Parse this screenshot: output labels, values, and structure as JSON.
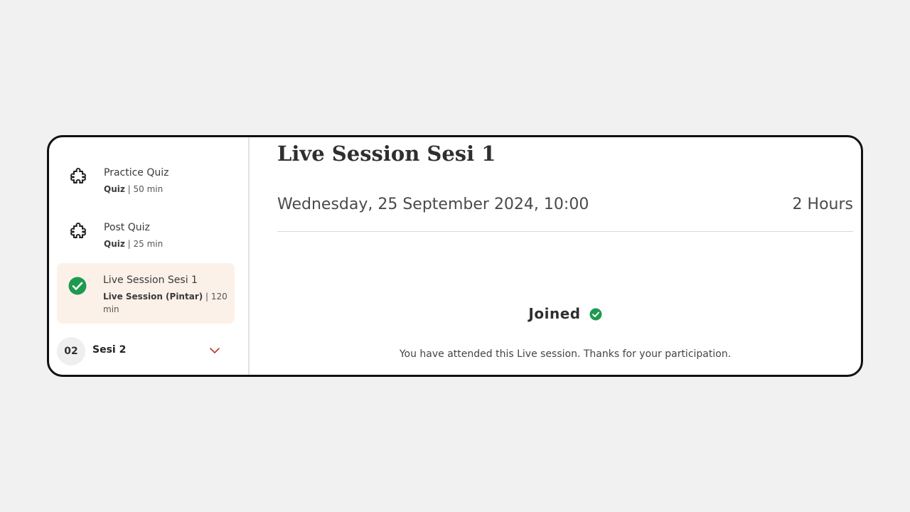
{
  "sidebar": {
    "items": [
      {
        "title": "Practice Quiz",
        "type": "Quiz",
        "duration": "| 50 min",
        "icon": "puzzle-icon"
      },
      {
        "title": "Post Quiz",
        "type": "Quiz",
        "duration": "| 25 min",
        "icon": "puzzle-icon"
      },
      {
        "title": "Live Session Sesi 1",
        "type": "Live Session (Pintar)",
        "duration": "| 120 min",
        "icon": "check-circle-icon",
        "active": true
      }
    ],
    "session": {
      "number": "02",
      "name": "Sesi 2",
      "icon": "chevron-down-icon"
    }
  },
  "main": {
    "title": "Live Session Sesi 1",
    "datetime": "Wednesday, 25 September 2024, 10:00",
    "duration": "2 Hours",
    "status": "Joined",
    "note": "You have attended this Live session. Thanks for your participation."
  },
  "colors": {
    "success": "#1e9a4f",
    "active_bg": "#fbf1e8",
    "chevron": "#c0392b",
    "frame_border": "#111111"
  }
}
